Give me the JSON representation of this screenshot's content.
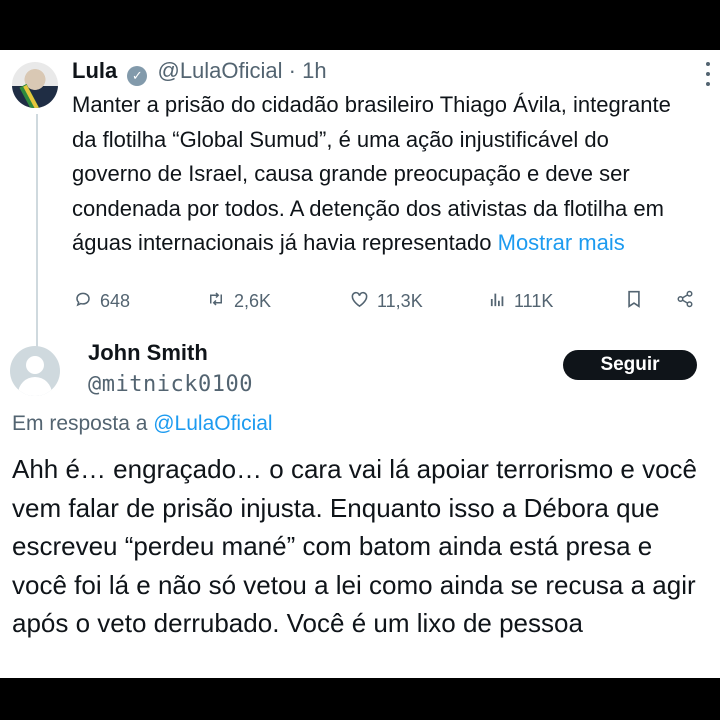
{
  "tweet": {
    "author_name": "Lula",
    "verified_glyph": "✓",
    "handle": "@LulaOficial",
    "separator": "·",
    "time": "1h",
    "text": "Manter a prisão do cidadão brasileiro Thiago Ávila, integrante da flotilha “Global Sumud”, é uma ação injustificável do governo de Israel, causa grande preocupação e deve ser condenada por todos. A detenção dos ativistas da flotilha em águas internacionais já havia representado ",
    "show_more": "Mostrar mais",
    "stats": {
      "replies": "648",
      "retweets": "2,6K",
      "likes": "11,3K",
      "views": "111K"
    },
    "icons": {
      "reply": "reply-icon",
      "retweet": "retweet-icon",
      "like": "heart-icon",
      "views": "views-icon",
      "bookmark": "bookmark-icon",
      "share": "share-icon"
    }
  },
  "reply": {
    "author_name": "John Smith",
    "handle": "@mitnick0100",
    "follow_label": "Seguir",
    "in_reply_to": "Em resposta a ",
    "in_reply_to_handle": "@LulaOficial",
    "text": "Ahh é… engraçado… o cara vai lá apoiar terrorismo e você vem falar de prisão injusta. Enquanto isso a Débora que escreveu “perdeu mané” com batom ainda está presa e você foi lá e não só vetou a lei como ainda se recusa a agir após o veto derrubado. Você é um lixo de pessoa"
  },
  "colors": {
    "link": "#1d9bf0",
    "muted": "#536471",
    "text": "#0f1419",
    "follow_button": "#0f1419"
  }
}
